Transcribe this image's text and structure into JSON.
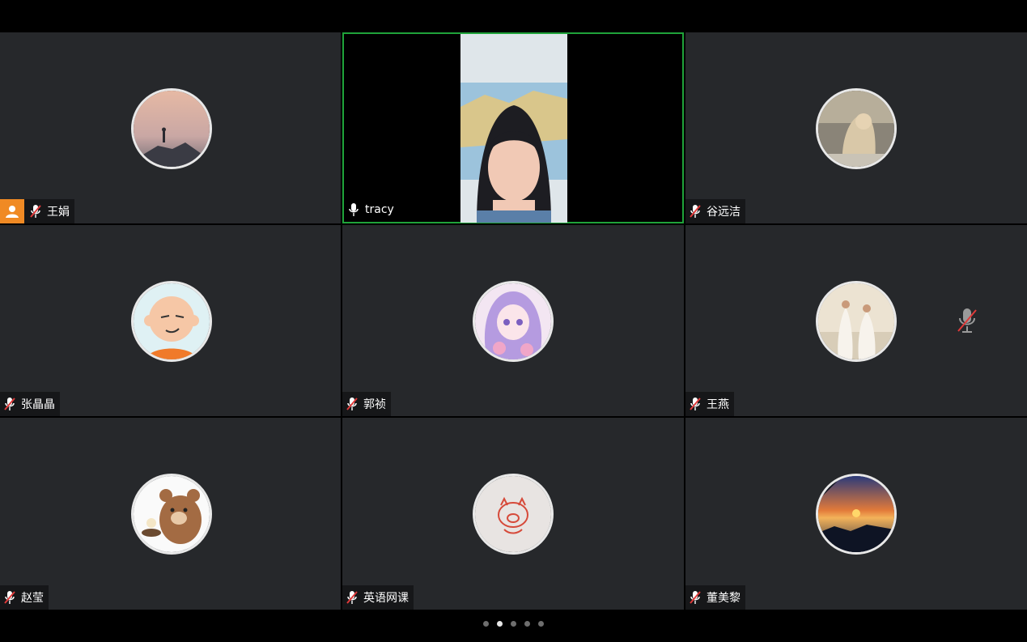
{
  "participants": [
    {
      "name": "王娟",
      "host": true,
      "mic": "muted",
      "active": false
    },
    {
      "name": "tracy",
      "host": false,
      "mic": "on",
      "active": true
    },
    {
      "name": "谷远洁",
      "host": false,
      "mic": "muted",
      "active": false
    },
    {
      "name": "张晶晶",
      "host": false,
      "mic": "muted",
      "active": false
    },
    {
      "name": "郭祯",
      "host": false,
      "mic": "muted",
      "active": false
    },
    {
      "name": "王燕",
      "host": false,
      "mic": "muted",
      "active": false
    },
    {
      "name": "赵莹",
      "host": false,
      "mic": "muted",
      "active": false
    },
    {
      "name": "英语网课",
      "host": false,
      "mic": "muted",
      "active": false
    },
    {
      "name": "董美黎",
      "host": false,
      "mic": "muted",
      "active": false
    }
  ],
  "pager": {
    "pages": 5,
    "current": 2
  },
  "colors": {
    "tile_bg": "#26282b",
    "active_border": "#1fa33a",
    "host_badge": "#f08a24",
    "mute_red": "#e03a3a"
  }
}
